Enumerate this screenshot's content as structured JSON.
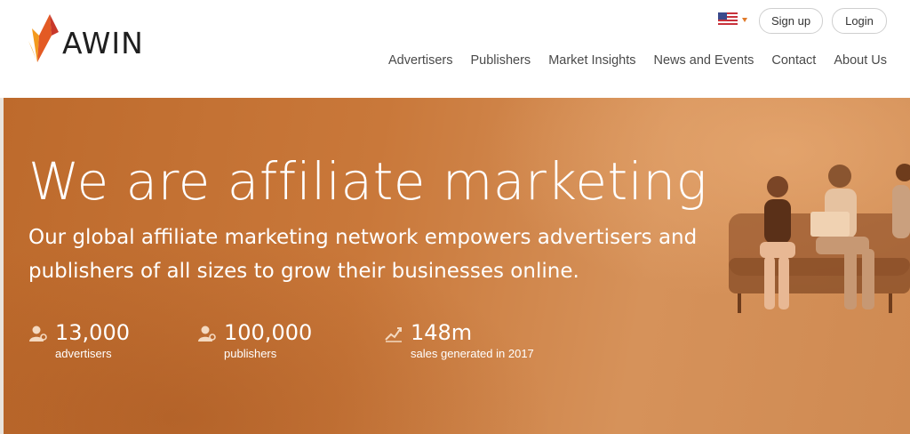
{
  "brand": {
    "name": "AWIN"
  },
  "header": {
    "locale_icon": "us-flag-icon",
    "signup_label": "Sign up",
    "login_label": "Login",
    "nav": [
      {
        "label": "Advertisers"
      },
      {
        "label": "Publishers"
      },
      {
        "label": "Market Insights"
      },
      {
        "label": "News and Events"
      },
      {
        "label": "Contact"
      },
      {
        "label": "About Us"
      }
    ]
  },
  "hero": {
    "headline": "We are affiliate marketing",
    "subhead": "Our global affiliate marketing network empowers advertisers and publishers of all sizes to grow their businesses online.",
    "stats": [
      {
        "icon": "person-link-icon",
        "value": "13,000",
        "label": "advertisers"
      },
      {
        "icon": "person-link-icon",
        "value": "100,000",
        "label": "publishers"
      },
      {
        "icon": "growth-chart-icon",
        "value": "148m",
        "label": "sales generated in 2017"
      }
    ]
  },
  "colors": {
    "accent_orange": "#e07a2a",
    "hero_orange": "#c9783a",
    "text_dark": "#1f1f1f"
  }
}
